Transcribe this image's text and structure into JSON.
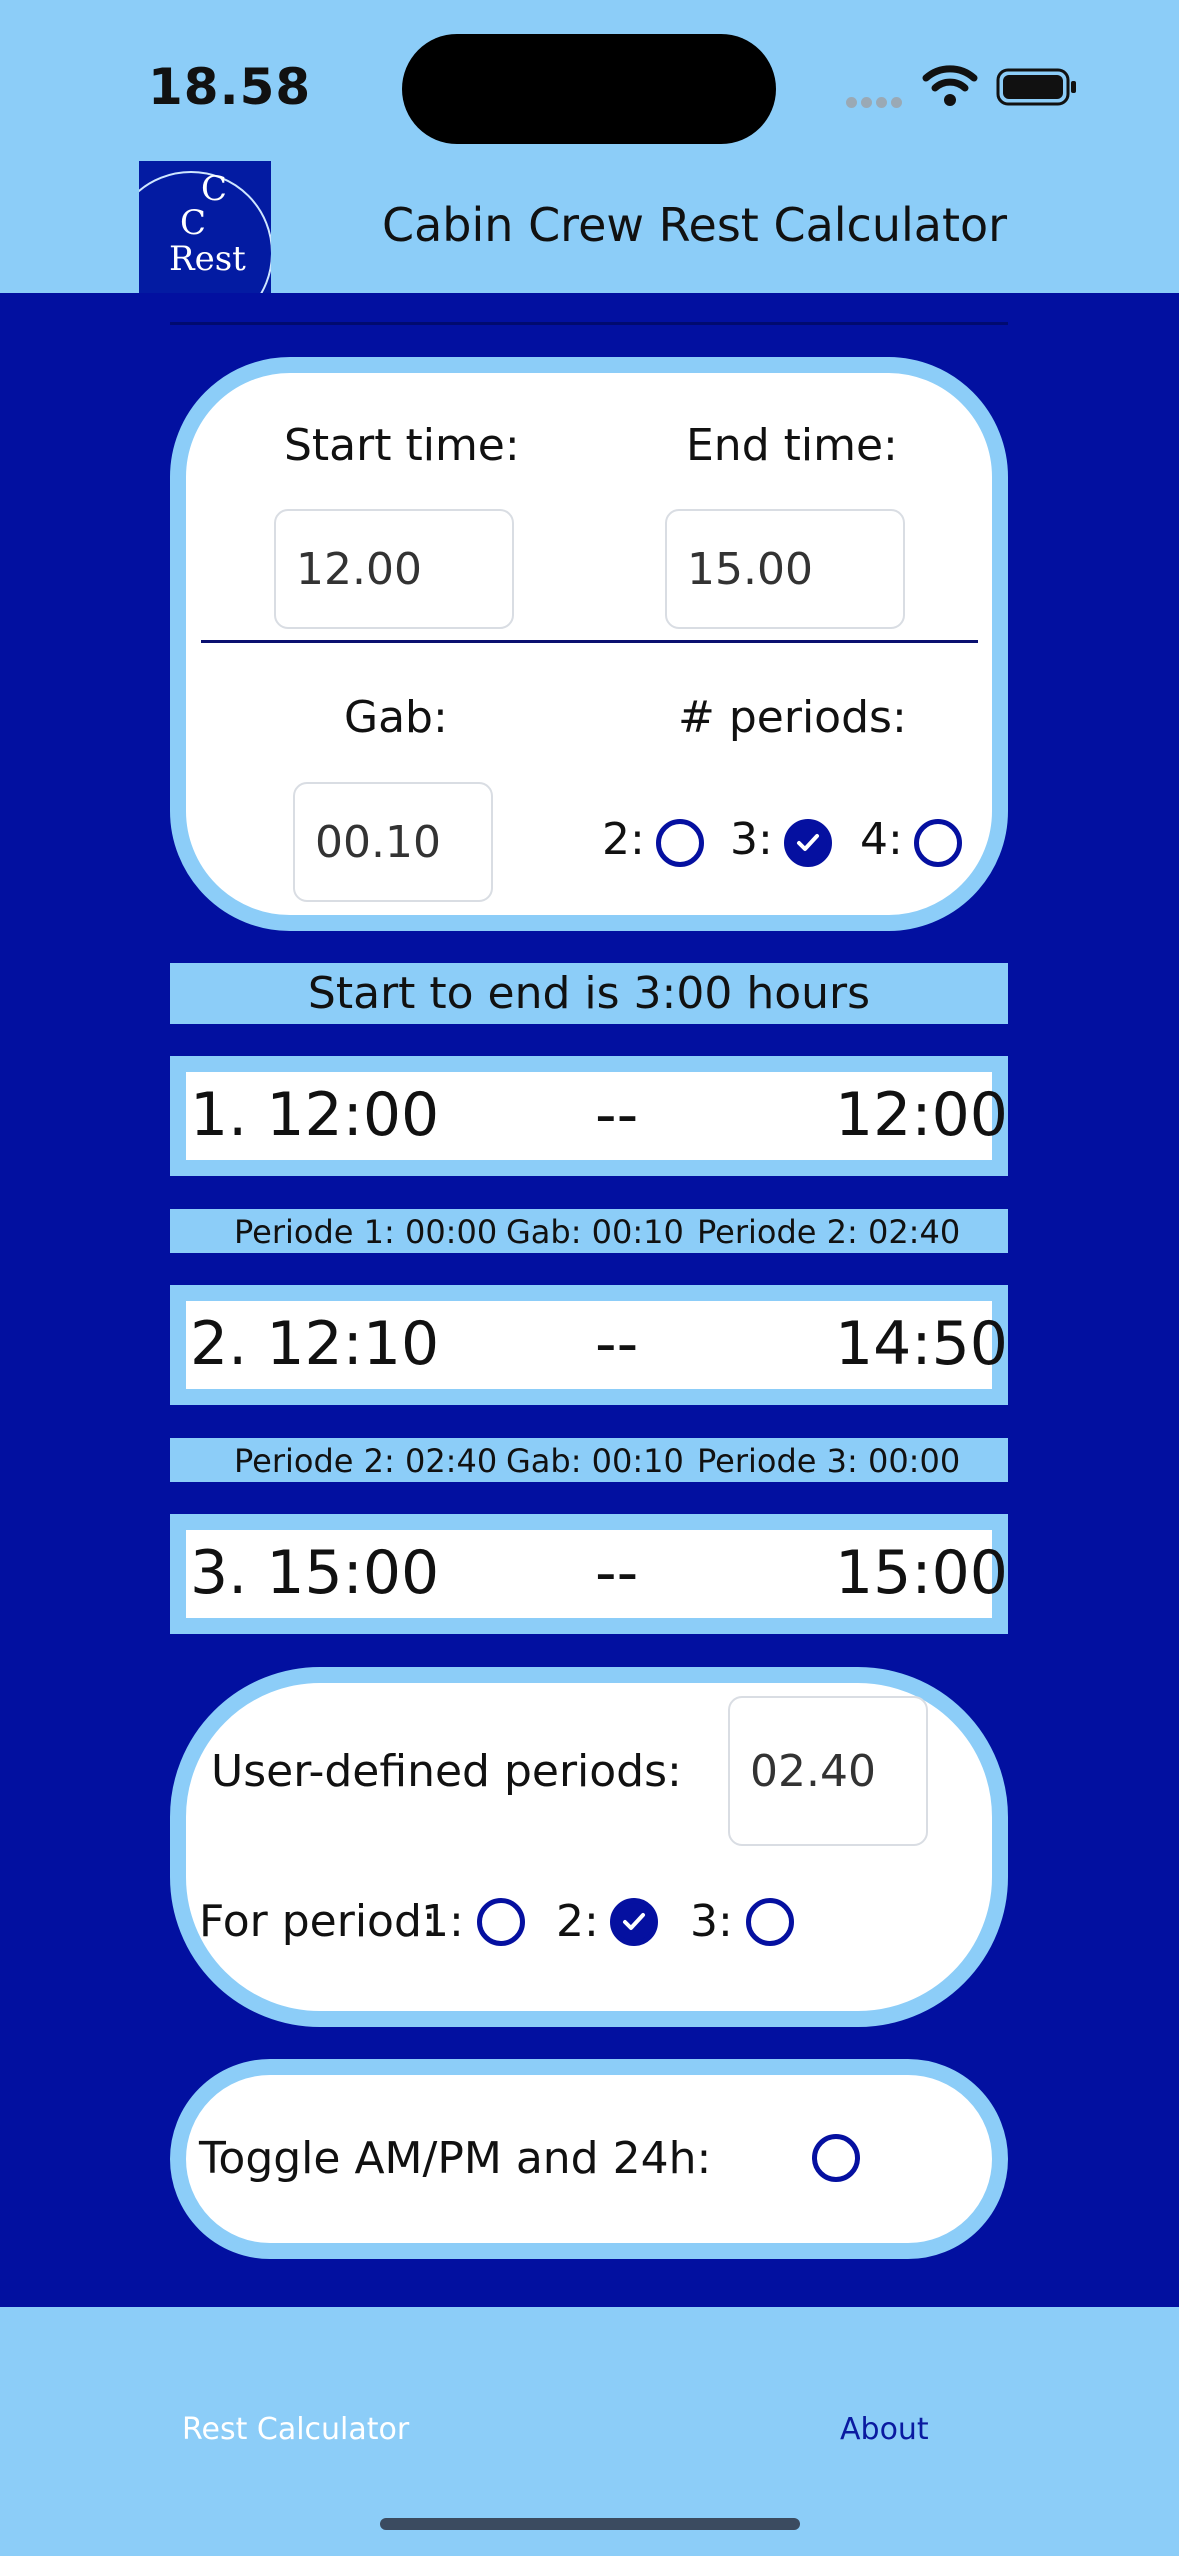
{
  "status_bar": {
    "time": "18.58"
  },
  "header": {
    "logo_letters": [
      "C",
      "C",
      "Rest"
    ],
    "title": "Cabin Crew Rest Calculator"
  },
  "times": {
    "start_label": "Start time:",
    "start_value": "12.00",
    "end_label": "End time:",
    "end_value": "15.00",
    "gab_label": "Gab:",
    "gab_value": "00.10",
    "periods_label": "# periods:",
    "period_options": [
      {
        "label": "2:",
        "selected": false
      },
      {
        "label": "3:",
        "selected": true
      },
      {
        "label": "4:",
        "selected": false
      }
    ]
  },
  "summary": "Start to end is 3:00 hours",
  "periods": [
    {
      "label": "1. 12:00",
      "sep": "--",
      "end": "12:00"
    },
    {
      "label": "2. 12:10",
      "sep": "--",
      "end": "14:50"
    },
    {
      "label": "3. 15:00",
      "sep": "--",
      "end": "15:00"
    }
  ],
  "gaps": [
    {
      "p1": "Periode 1: 00:00",
      "gab": "Gab: 00:10",
      "p2": "Periode 2: 02:40"
    },
    {
      "p1": "Periode 2: 02:40",
      "gab": "Gab: 00:10",
      "p2": "Periode 3: 00:00"
    }
  ],
  "user_defined": {
    "label": "User-defined periods:",
    "value": "02.40",
    "for_label": "For period:",
    "options": [
      {
        "label": "1:",
        "selected": false
      },
      {
        "label": "2:",
        "selected": true
      },
      {
        "label": "3:",
        "selected": false
      }
    ]
  },
  "toggle": {
    "label": "Toggle AM/PM and 24h:",
    "on": false
  },
  "tabs": {
    "rest": "Rest Calculator",
    "about": "About"
  },
  "colors": {
    "background": "#0210A0",
    "light": "#8CCDF8",
    "accent": "#0510A0"
  }
}
